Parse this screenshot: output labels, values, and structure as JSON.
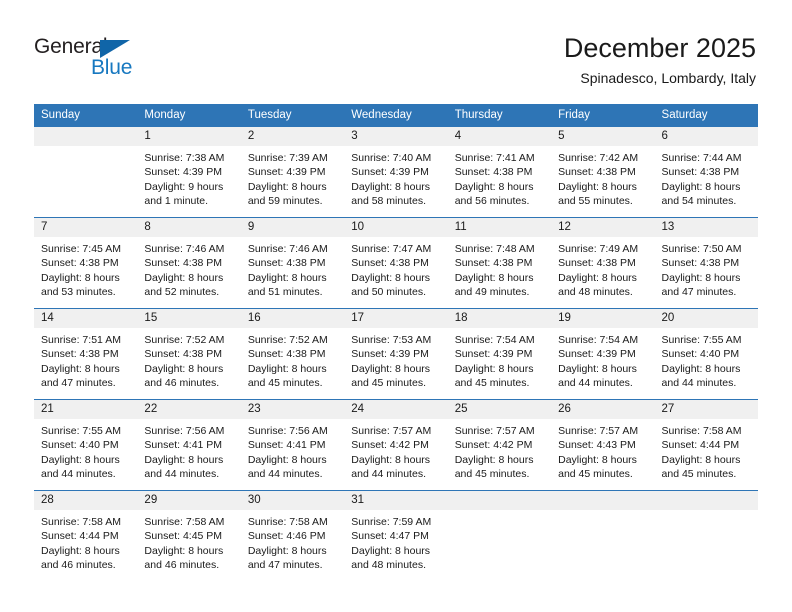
{
  "logo": {
    "text_primary": "General",
    "text_secondary": "Blue",
    "triangle_color": "#1065a8",
    "secondary_color": "#1778c0"
  },
  "header": {
    "title": "December 2025",
    "subtitle": "Spinadesco, Lombardy, Italy"
  },
  "theme": {
    "header_blue": "#2e75b6",
    "date_band_gray": "#f0f0f0",
    "text_color": "#1a1a1a"
  },
  "weekday_headers": [
    "Sunday",
    "Monday",
    "Tuesday",
    "Wednesday",
    "Thursday",
    "Friday",
    "Saturday"
  ],
  "weeks": [
    [
      {
        "day": "",
        "sunrise": "",
        "sunset": "",
        "daylight_line1": "",
        "daylight_line2": ""
      },
      {
        "day": "1",
        "sunrise": "Sunrise: 7:38 AM",
        "sunset": "Sunset: 4:39 PM",
        "daylight_line1": "Daylight: 9 hours",
        "daylight_line2": "and 1 minute."
      },
      {
        "day": "2",
        "sunrise": "Sunrise: 7:39 AM",
        "sunset": "Sunset: 4:39 PM",
        "daylight_line1": "Daylight: 8 hours",
        "daylight_line2": "and 59 minutes."
      },
      {
        "day": "3",
        "sunrise": "Sunrise: 7:40 AM",
        "sunset": "Sunset: 4:39 PM",
        "daylight_line1": "Daylight: 8 hours",
        "daylight_line2": "and 58 minutes."
      },
      {
        "day": "4",
        "sunrise": "Sunrise: 7:41 AM",
        "sunset": "Sunset: 4:38 PM",
        "daylight_line1": "Daylight: 8 hours",
        "daylight_line2": "and 56 minutes."
      },
      {
        "day": "5",
        "sunrise": "Sunrise: 7:42 AM",
        "sunset": "Sunset: 4:38 PM",
        "daylight_line1": "Daylight: 8 hours",
        "daylight_line2": "and 55 minutes."
      },
      {
        "day": "6",
        "sunrise": "Sunrise: 7:44 AM",
        "sunset": "Sunset: 4:38 PM",
        "daylight_line1": "Daylight: 8 hours",
        "daylight_line2": "and 54 minutes."
      }
    ],
    [
      {
        "day": "7",
        "sunrise": "Sunrise: 7:45 AM",
        "sunset": "Sunset: 4:38 PM",
        "daylight_line1": "Daylight: 8 hours",
        "daylight_line2": "and 53 minutes."
      },
      {
        "day": "8",
        "sunrise": "Sunrise: 7:46 AM",
        "sunset": "Sunset: 4:38 PM",
        "daylight_line1": "Daylight: 8 hours",
        "daylight_line2": "and 52 minutes."
      },
      {
        "day": "9",
        "sunrise": "Sunrise: 7:46 AM",
        "sunset": "Sunset: 4:38 PM",
        "daylight_line1": "Daylight: 8 hours",
        "daylight_line2": "and 51 minutes."
      },
      {
        "day": "10",
        "sunrise": "Sunrise: 7:47 AM",
        "sunset": "Sunset: 4:38 PM",
        "daylight_line1": "Daylight: 8 hours",
        "daylight_line2": "and 50 minutes."
      },
      {
        "day": "11",
        "sunrise": "Sunrise: 7:48 AM",
        "sunset": "Sunset: 4:38 PM",
        "daylight_line1": "Daylight: 8 hours",
        "daylight_line2": "and 49 minutes."
      },
      {
        "day": "12",
        "sunrise": "Sunrise: 7:49 AM",
        "sunset": "Sunset: 4:38 PM",
        "daylight_line1": "Daylight: 8 hours",
        "daylight_line2": "and 48 minutes."
      },
      {
        "day": "13",
        "sunrise": "Sunrise: 7:50 AM",
        "sunset": "Sunset: 4:38 PM",
        "daylight_line1": "Daylight: 8 hours",
        "daylight_line2": "and 47 minutes."
      }
    ],
    [
      {
        "day": "14",
        "sunrise": "Sunrise: 7:51 AM",
        "sunset": "Sunset: 4:38 PM",
        "daylight_line1": "Daylight: 8 hours",
        "daylight_line2": "and 47 minutes."
      },
      {
        "day": "15",
        "sunrise": "Sunrise: 7:52 AM",
        "sunset": "Sunset: 4:38 PM",
        "daylight_line1": "Daylight: 8 hours",
        "daylight_line2": "and 46 minutes."
      },
      {
        "day": "16",
        "sunrise": "Sunrise: 7:52 AM",
        "sunset": "Sunset: 4:38 PM",
        "daylight_line1": "Daylight: 8 hours",
        "daylight_line2": "and 45 minutes."
      },
      {
        "day": "17",
        "sunrise": "Sunrise: 7:53 AM",
        "sunset": "Sunset: 4:39 PM",
        "daylight_line1": "Daylight: 8 hours",
        "daylight_line2": "and 45 minutes."
      },
      {
        "day": "18",
        "sunrise": "Sunrise: 7:54 AM",
        "sunset": "Sunset: 4:39 PM",
        "daylight_line1": "Daylight: 8 hours",
        "daylight_line2": "and 45 minutes."
      },
      {
        "day": "19",
        "sunrise": "Sunrise: 7:54 AM",
        "sunset": "Sunset: 4:39 PM",
        "daylight_line1": "Daylight: 8 hours",
        "daylight_line2": "and 44 minutes."
      },
      {
        "day": "20",
        "sunrise": "Sunrise: 7:55 AM",
        "sunset": "Sunset: 4:40 PM",
        "daylight_line1": "Daylight: 8 hours",
        "daylight_line2": "and 44 minutes."
      }
    ],
    [
      {
        "day": "21",
        "sunrise": "Sunrise: 7:55 AM",
        "sunset": "Sunset: 4:40 PM",
        "daylight_line1": "Daylight: 8 hours",
        "daylight_line2": "and 44 minutes."
      },
      {
        "day": "22",
        "sunrise": "Sunrise: 7:56 AM",
        "sunset": "Sunset: 4:41 PM",
        "daylight_line1": "Daylight: 8 hours",
        "daylight_line2": "and 44 minutes."
      },
      {
        "day": "23",
        "sunrise": "Sunrise: 7:56 AM",
        "sunset": "Sunset: 4:41 PM",
        "daylight_line1": "Daylight: 8 hours",
        "daylight_line2": "and 44 minutes."
      },
      {
        "day": "24",
        "sunrise": "Sunrise: 7:57 AM",
        "sunset": "Sunset: 4:42 PM",
        "daylight_line1": "Daylight: 8 hours",
        "daylight_line2": "and 44 minutes."
      },
      {
        "day": "25",
        "sunrise": "Sunrise: 7:57 AM",
        "sunset": "Sunset: 4:42 PM",
        "daylight_line1": "Daylight: 8 hours",
        "daylight_line2": "and 45 minutes."
      },
      {
        "day": "26",
        "sunrise": "Sunrise: 7:57 AM",
        "sunset": "Sunset: 4:43 PM",
        "daylight_line1": "Daylight: 8 hours",
        "daylight_line2": "and 45 minutes."
      },
      {
        "day": "27",
        "sunrise": "Sunrise: 7:58 AM",
        "sunset": "Sunset: 4:44 PM",
        "daylight_line1": "Daylight: 8 hours",
        "daylight_line2": "and 45 minutes."
      }
    ],
    [
      {
        "day": "28",
        "sunrise": "Sunrise: 7:58 AM",
        "sunset": "Sunset: 4:44 PM",
        "daylight_line1": "Daylight: 8 hours",
        "daylight_line2": "and 46 minutes."
      },
      {
        "day": "29",
        "sunrise": "Sunrise: 7:58 AM",
        "sunset": "Sunset: 4:45 PM",
        "daylight_line1": "Daylight: 8 hours",
        "daylight_line2": "and 46 minutes."
      },
      {
        "day": "30",
        "sunrise": "Sunrise: 7:58 AM",
        "sunset": "Sunset: 4:46 PM",
        "daylight_line1": "Daylight: 8 hours",
        "daylight_line2": "and 47 minutes."
      },
      {
        "day": "31",
        "sunrise": "Sunrise: 7:59 AM",
        "sunset": "Sunset: 4:47 PM",
        "daylight_line1": "Daylight: 8 hours",
        "daylight_line2": "and 48 minutes."
      },
      {
        "day": "",
        "sunrise": "",
        "sunset": "",
        "daylight_line1": "",
        "daylight_line2": ""
      },
      {
        "day": "",
        "sunrise": "",
        "sunset": "",
        "daylight_line1": "",
        "daylight_line2": ""
      },
      {
        "day": "",
        "sunrise": "",
        "sunset": "",
        "daylight_line1": "",
        "daylight_line2": ""
      }
    ]
  ]
}
